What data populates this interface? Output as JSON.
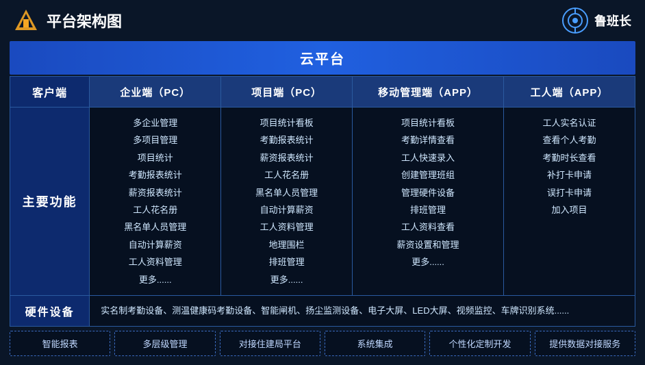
{
  "header": {
    "title": "平台架构图",
    "brand_name": "鲁班长"
  },
  "cloud_platform": {
    "label": "云平台"
  },
  "columns": {
    "client": "客户端",
    "enterprise_pc": "企业端（PC）",
    "project_pc": "项目端（PC）",
    "mobile_app": "移动管理端（APP）",
    "worker_app": "工人端（APP）"
  },
  "main_features": {
    "label": "主要功能",
    "enterprise_list": [
      "多企业管理",
      "多项目管理",
      "项目统计",
      "考勤报表统计",
      "薪资报表统计",
      "工人花名册",
      "黑名单人员管理",
      "自动计算薪资",
      "工人资料管理",
      "更多......"
    ],
    "project_list": [
      "项目统计看板",
      "考勤报表统计",
      "薪资报表统计",
      "工人花名册",
      "黑名单人员管理",
      "自动计算薪资",
      "工人资料管理",
      "地理围栏",
      "排班管理",
      "更多......"
    ],
    "mobile_list": [
      "项目统计看板",
      "考勤详情查看",
      "工人快速录入",
      "创建管理班组",
      "管理硬件设备",
      "排班管理",
      "工人资料查看",
      "薪资设置和管理",
      "更多......"
    ],
    "worker_list": [
      "工人实名认证",
      "查看个人考勤",
      "考勤时长查看",
      "补打卡申请",
      "误打卡申请",
      "加入项目"
    ]
  },
  "hardware": {
    "label": "硬件设备",
    "content": "实名制考勤设备、测温健康码考勤设备、智能闸机、扬尘监测设备、电子大屏、LED大屏、视频监控、车牌识别系统......"
  },
  "services": [
    "智能报表",
    "多层级管理",
    "对接住建局平台",
    "系统集成",
    "个性化定制开发",
    "提供数据对接服务"
  ]
}
